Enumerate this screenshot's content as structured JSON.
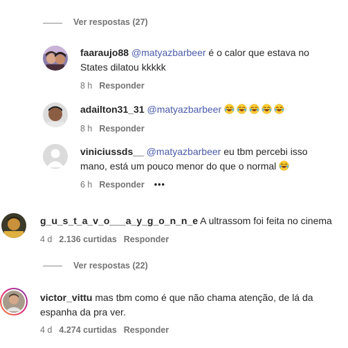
{
  "top_thread": {
    "view_replies": "Ver respostas (27)"
  },
  "replies": [
    {
      "username": "faaraujo88",
      "mention": "@matyazbarbeer",
      "text": " é o calor que estava no States dilatou kkkkk",
      "time": "8 h",
      "reply_label": "Responder"
    },
    {
      "username": "adailton31_31",
      "mention": "@matyazbarbeer",
      "text": "",
      "emoji": "laughing-tears-emoji",
      "emoji_count": 5,
      "time": "8 h",
      "reply_label": "Responder"
    },
    {
      "username": "viniciussds__",
      "mention": "@matyazbarbeer",
      "text": " eu tbm percebi isso mano, está um pouco menor do que o normal",
      "emoji": "laughing-tears-emoji",
      "time": "6 h",
      "reply_label": "Responder",
      "more_label": "•••"
    }
  ],
  "comments": [
    {
      "username": "g_u_s_t_a_v_o___a_y_g_o_n_n_e",
      "text": " A ultrassom foi feita no cinema",
      "time": "4 d",
      "likes": "2.136 curtidas",
      "reply_label": "Responder",
      "view_replies": "Ver respostas (22)"
    },
    {
      "username": "victor_vittu",
      "text": "  mas tbm como é que não chama atenção, de lá da espanha da pra ver.",
      "time": "4 d",
      "likes": "4.274 curtidas",
      "reply_label": "Responder"
    }
  ],
  "colors": {
    "text": "#262626",
    "secondary": "#737373",
    "mention": "#4a5bab",
    "story_ring": "#d6249f"
  }
}
